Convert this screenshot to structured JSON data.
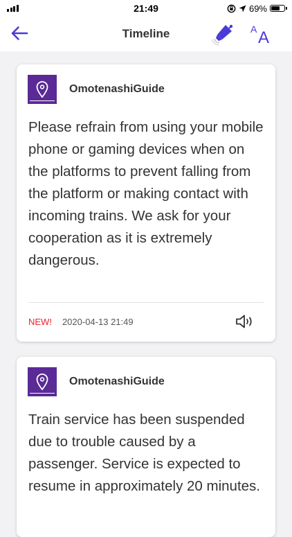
{
  "status_bar": {
    "time": "21:49",
    "battery_text": "69%",
    "battery_level": 0.69
  },
  "nav": {
    "title": "Timeline",
    "back_icon": "back-arrow-icon",
    "alert_icon": "notification-horn-icon",
    "font_icon": "font-size-icon",
    "font_glyph_small": "A",
    "font_glyph_large": "A"
  },
  "colors": {
    "accent": "#4a3bd6",
    "brand_purple": "#5a2a96",
    "new_badge": "#e8232b"
  },
  "timeline": [
    {
      "source": "OmotenashiGuide",
      "message": "Please refrain from using your mobile phone or gaming devices when on the platforms to prevent falling from the platform or making contact with incoming trains. We ask for your cooperation as it is extremely dangerous.",
      "badge": "NEW!",
      "timestamp": "2020-04-13 21:49",
      "speaker_icon": "speaker-icon"
    },
    {
      "source": "OmotenashiGuide",
      "message": "Train service has been suspended due to trouble caused by a passenger. Service is expected to resume in approximately 20 minutes."
    }
  ]
}
